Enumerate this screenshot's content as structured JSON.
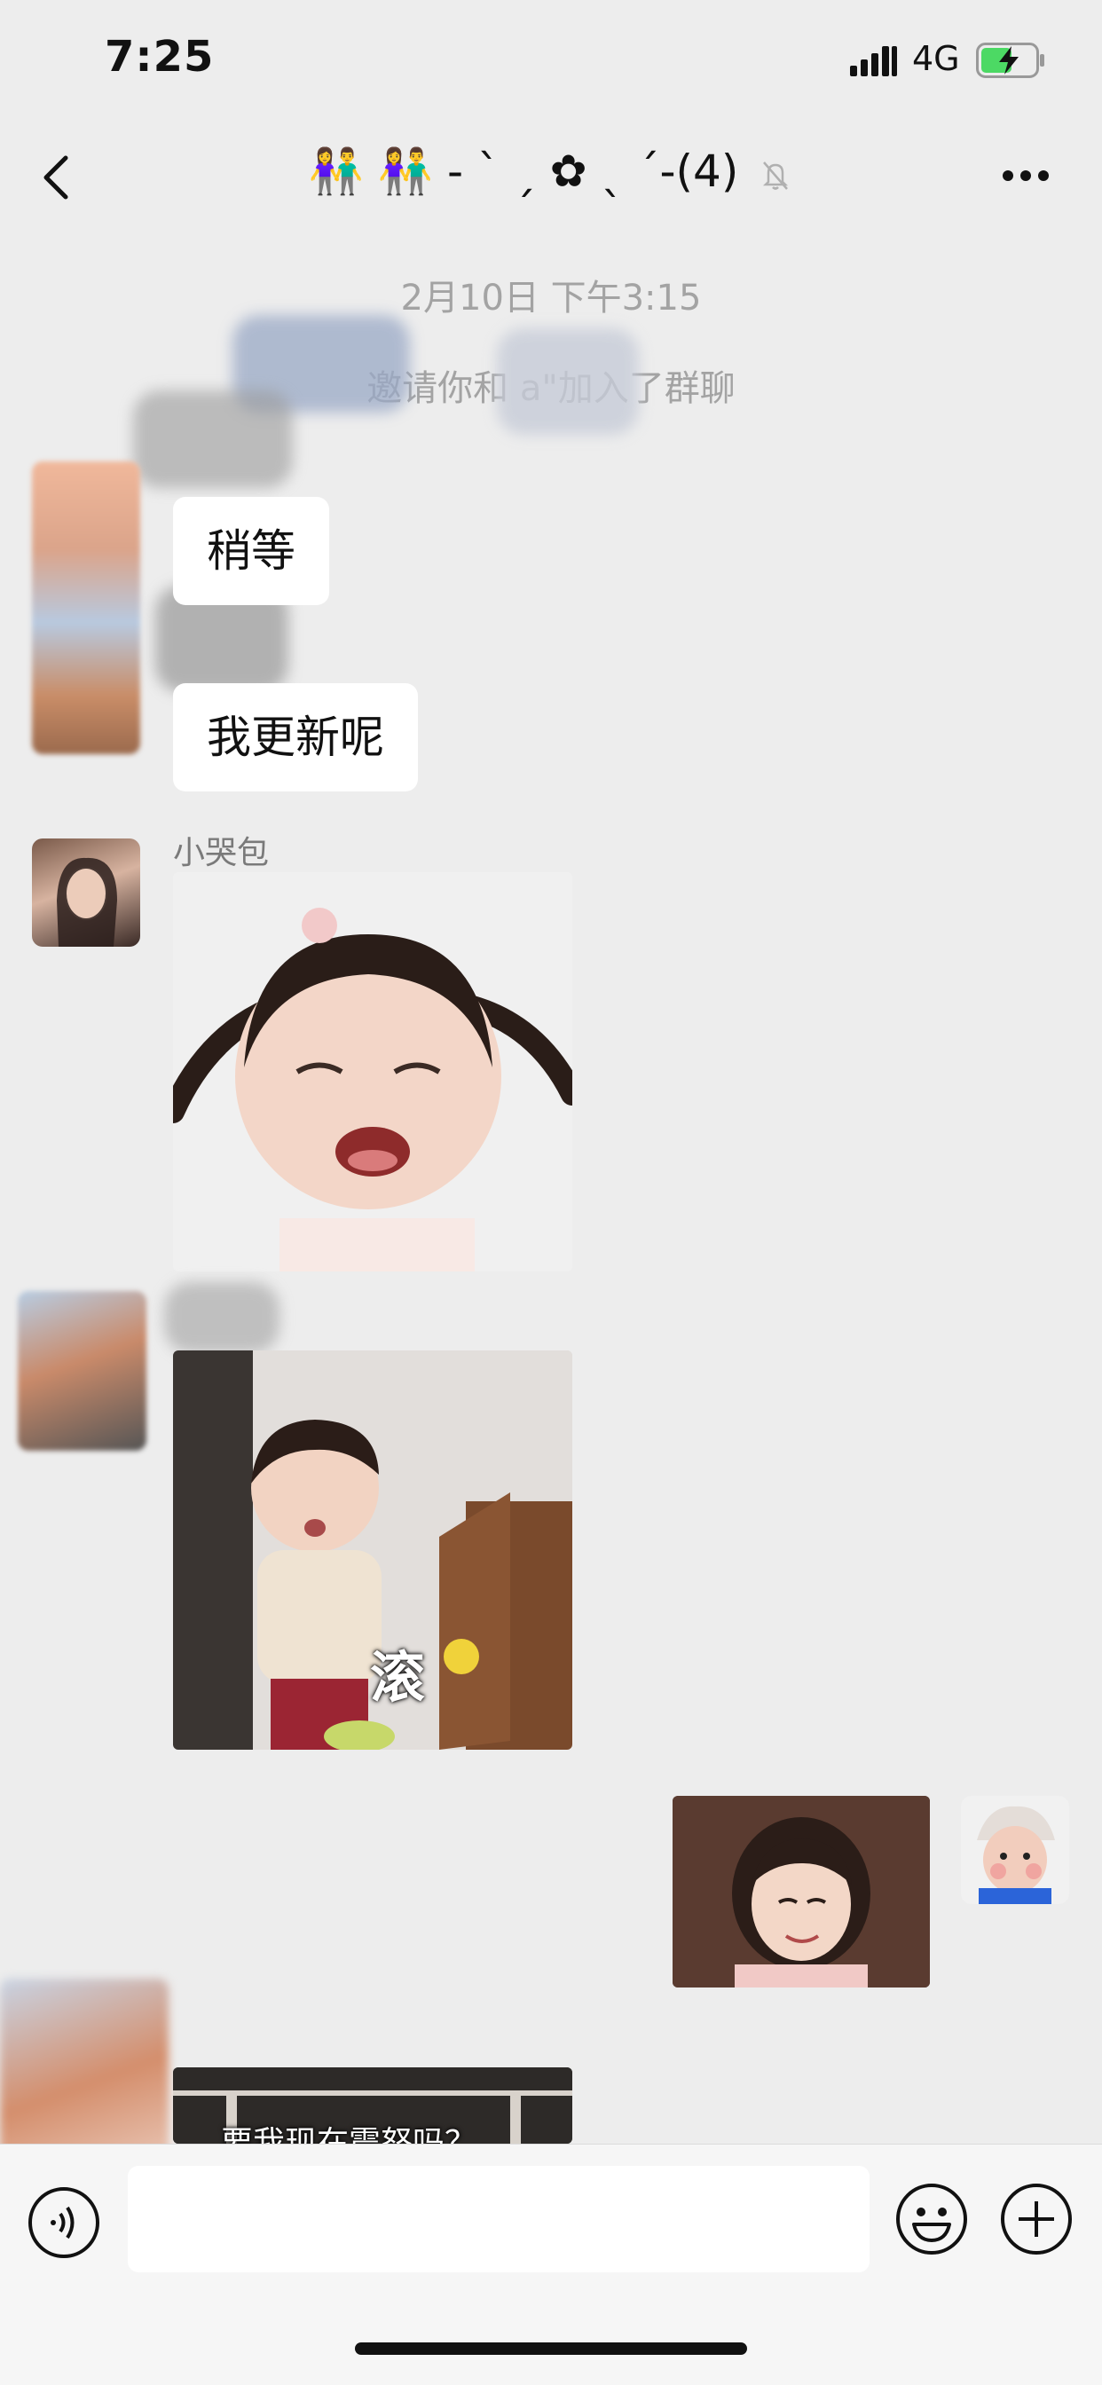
{
  "status_bar": {
    "time": "7:25",
    "network": "4G",
    "icons": [
      "signal-icon",
      "battery-charging-icon"
    ]
  },
  "nav": {
    "title": "👫 👫 - ` ˏ ✿ ˎ ´-(4)",
    "icons": [
      "back-icon",
      "mute-bell-icon",
      "more-icon"
    ]
  },
  "chat": {
    "timestamp": "2月10日 下午3:15",
    "system_notice": "邀请你和 a\"加入了群聊",
    "messages": [
      {
        "type": "text",
        "direction": "incoming",
        "text": "稍等"
      },
      {
        "type": "text",
        "direction": "incoming",
        "text": "我更新呢"
      },
      {
        "type": "sticker",
        "direction": "incoming",
        "sender": "小哭包",
        "caption": ""
      },
      {
        "type": "sticker",
        "direction": "incoming",
        "sender": "",
        "caption": "滚"
      },
      {
        "type": "sticker",
        "direction": "outgoing",
        "caption": ""
      },
      {
        "type": "sticker",
        "direction": "incoming",
        "caption": "要我现在震怒吗？"
      }
    ]
  },
  "input_bar": {
    "placeholder": "",
    "icons": [
      "voice-icon",
      "emoji-icon",
      "plus-icon"
    ]
  },
  "colors": {
    "background": "#ededed",
    "bubble": "#ffffff",
    "muted_text": "#a3a3a3",
    "battery_green": "#4cd964"
  }
}
